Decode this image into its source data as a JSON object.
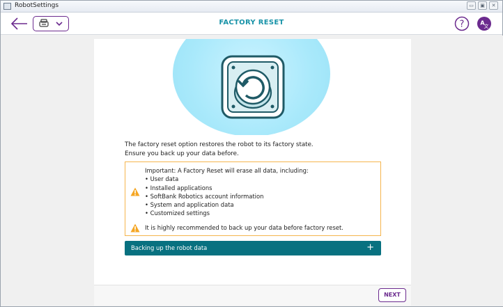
{
  "window": {
    "title": "RobotSettings"
  },
  "header": {
    "title": "FACTORY RESET"
  },
  "main": {
    "intro_line1": "The factory reset option restores the robot to its factory state.",
    "intro_line2": "Ensure you back up your data before.",
    "warning": {
      "heading": "Important: A Factory Reset will erase all data, including:",
      "items": [
        "User data",
        "Installed applications",
        "SoftBank Robotics account information",
        "System and application data",
        "Customized settings"
      ],
      "note": "It is highly recommended to back up your data before factory reset."
    },
    "accordion": {
      "label": "Backing up the robot data",
      "expand_symbol": "+"
    }
  },
  "footer": {
    "next_label": "NEXT"
  },
  "icons": {
    "back": "arrow-left-icon",
    "robot": "robot-icon",
    "chevron": "chevron-down-icon",
    "help": "help-icon",
    "language": "language-icon",
    "reset": "factory-reset-icon",
    "warning": "warning-icon"
  },
  "colors": {
    "accent_purple": "#6b2a8e",
    "title_teal": "#1893a8",
    "accordion_teal": "#087180",
    "warning_orange": "#f5a623",
    "hero_blue": "#a9e9fb",
    "icon_dark": "#1f5a66"
  }
}
